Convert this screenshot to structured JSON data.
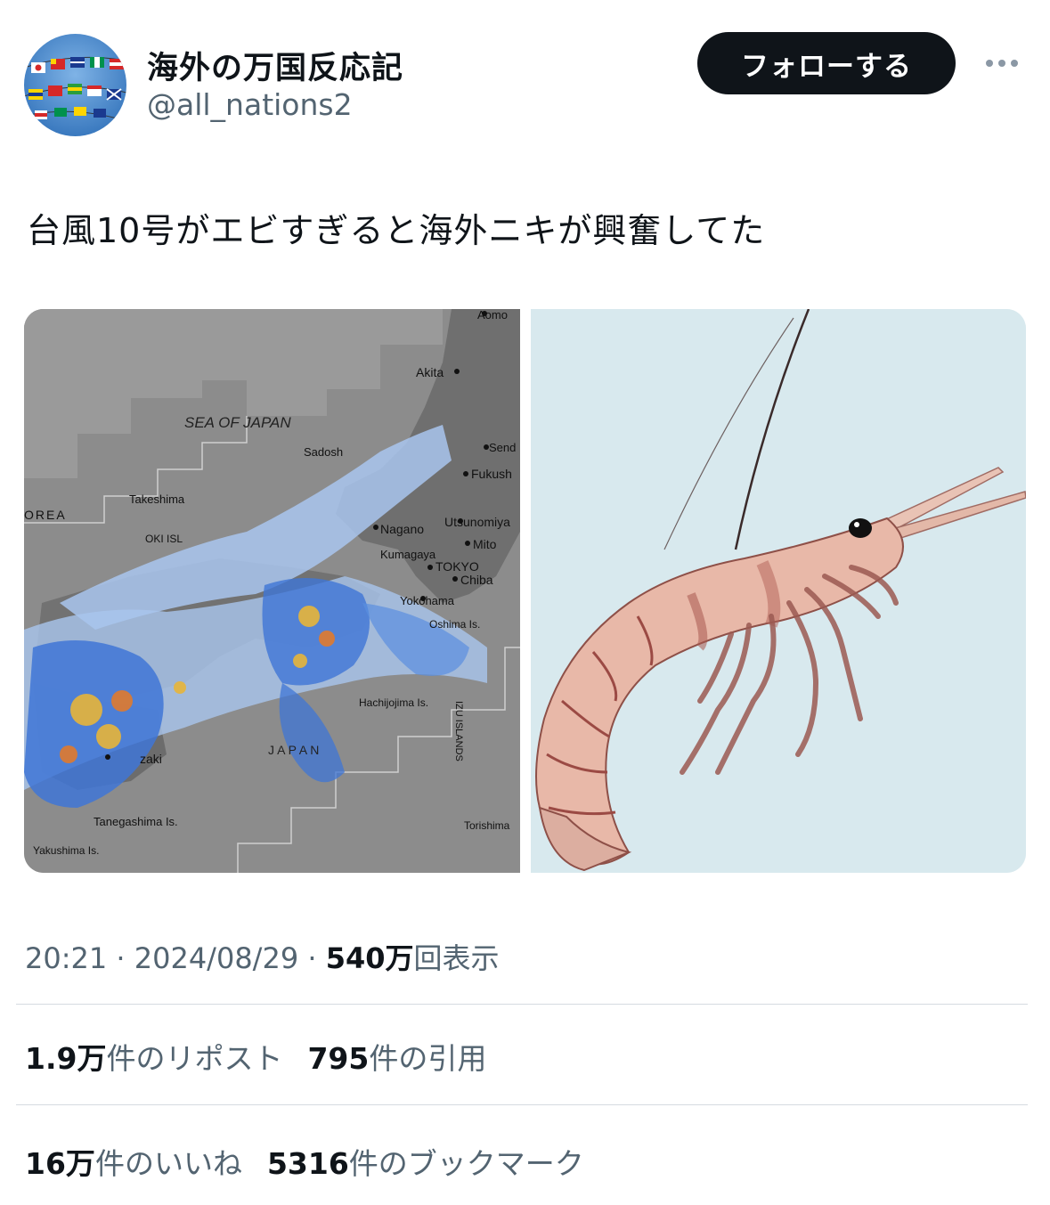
{
  "user": {
    "display_name": "海外の万国反応記",
    "handle": "@all_nations2",
    "follow_label": "フォローする",
    "avatar_icon": "flags-avatar-icon",
    "more_icon": "more-options-icon"
  },
  "tweet": {
    "text": "台風10号がエビすぎると海外ニキが興奮してた",
    "time": "20:21",
    "date": "2024/08/29",
    "views_count": "540万",
    "views_label": "回表示"
  },
  "media": {
    "map": {
      "sea_label": "SEA OF JAPAN",
      "labels": {
        "aomori": "Aomo",
        "akita": "Akita",
        "sendai": "Send",
        "fukushima": "Fukush",
        "sado": "Sadosh",
        "takeshima": "Takeshima",
        "korea": "OREA",
        "oki": "OKI ISL",
        "nagano": "Nagano",
        "utsunomiya": "Utsunomiya",
        "mito": "Mito",
        "kumagaya": "Kumagaya",
        "tokyo": "TOKYO",
        "chiba": "Chiba",
        "yokohama": "Yokohama",
        "oshima": "Oshima Is.",
        "hachijojima": "Hachijojima Is.",
        "izu": "IZU ISLANDS",
        "miyazaki": "zaki",
        "tanegashima": "Tanegashima Is.",
        "yakushima": "Yakushima Is.",
        "torishima": "Torishima",
        "japan": "J  A  P  A  N"
      }
    },
    "shrimp": {
      "icon": "shrimp-illustration-icon"
    }
  },
  "stats": {
    "reposts_count": "1.9万",
    "reposts_label": "件のリポスト",
    "quotes_count": "795",
    "quotes_label": "件の引用",
    "likes_count": "16万",
    "likes_label": "件のいいね",
    "bookmarks_count": "5316",
    "bookmarks_label": "件のブックマーク"
  },
  "colors": {
    "follow_bg": "#0f1419",
    "secondary_text": "#536471",
    "divider": "#d5dbe0",
    "radar_light": "#a9c6ee",
    "radar_mid": "#3f76d6",
    "radar_heavy": "#e7b53a"
  }
}
